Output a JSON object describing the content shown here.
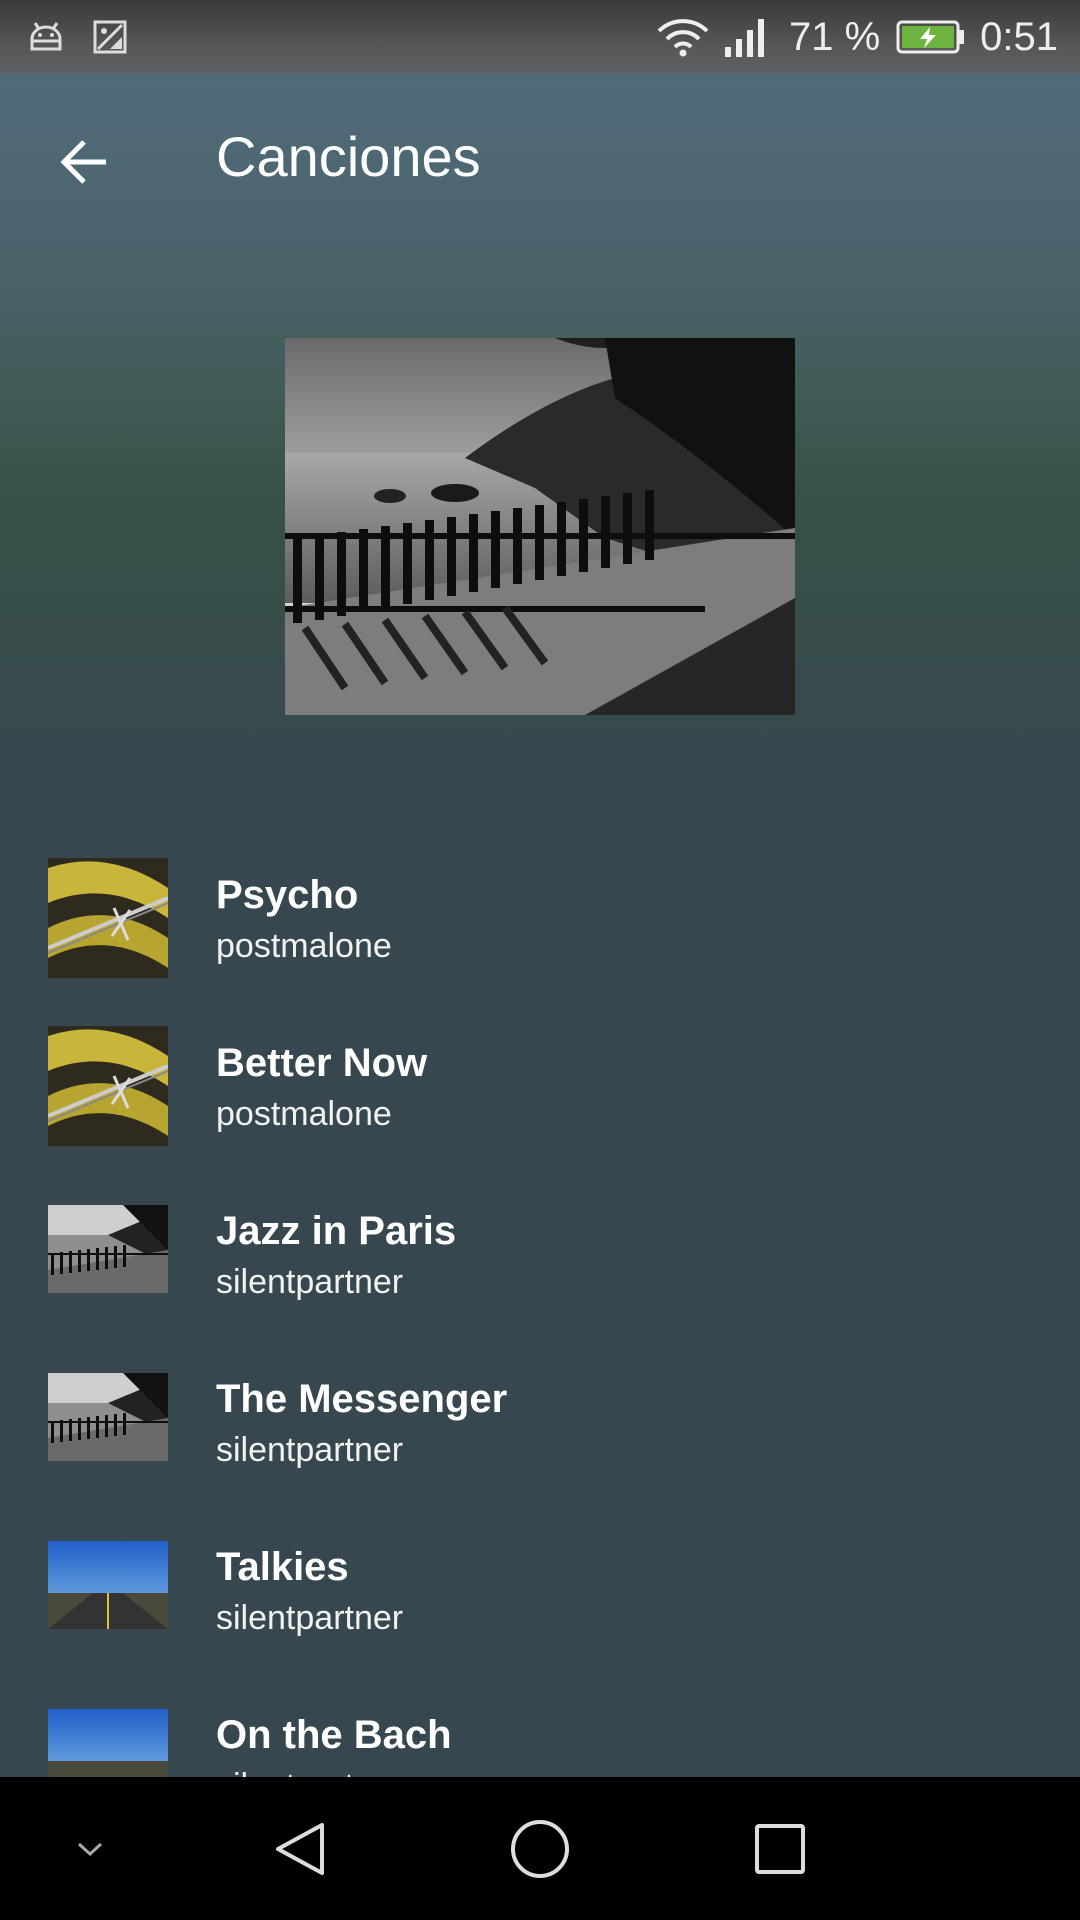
{
  "status_bar": {
    "left_icons": [
      "android-debug-icon",
      "image-icon"
    ],
    "battery_percent": "71 %",
    "time": "0:51",
    "wifi": "wifi-icon",
    "signal": "signal-icon",
    "battery": "battery-charging-icon"
  },
  "app_bar": {
    "title": "Canciones",
    "back_icon": "arrow-back-icon"
  },
  "songs": [
    {
      "title": "Psycho",
      "artist": "postmalone",
      "art": "barbed-wire"
    },
    {
      "title": "Better Now",
      "artist": "postmalone",
      "art": "barbed-wire"
    },
    {
      "title": "Jazz in Paris",
      "artist": "silentpartner",
      "art": "coast-fence"
    },
    {
      "title": "The Messenger",
      "artist": "silentpartner",
      "art": "coast-fence"
    },
    {
      "title": "Talkies",
      "artist": "silentpartner",
      "art": "road"
    },
    {
      "title": "On the Bach",
      "artist": "silentpartner",
      "art": "road"
    }
  ],
  "nav_bar": {
    "items": [
      "collapse-icon",
      "back-icon",
      "home-icon",
      "recents-icon"
    ]
  },
  "colors": {
    "background": "#37474f",
    "header_top": "#4f6b78",
    "header_mid": "#3f5a55",
    "nav_bar": "#000000"
  }
}
